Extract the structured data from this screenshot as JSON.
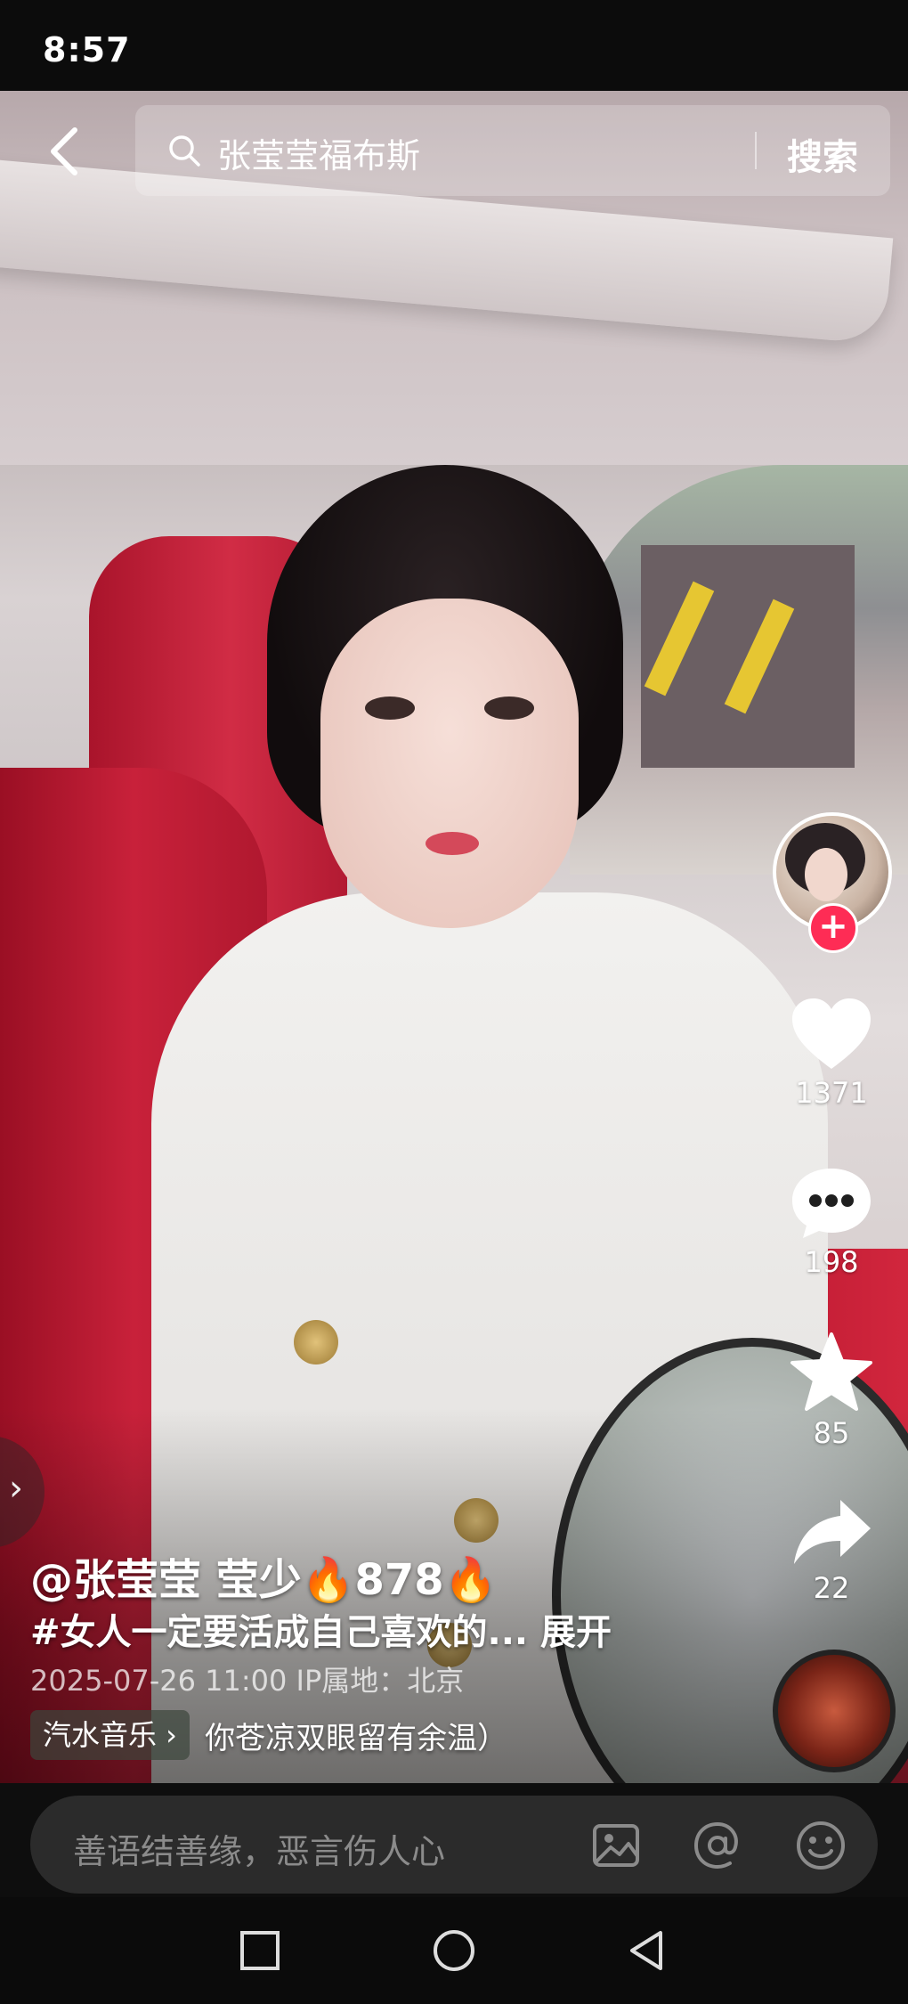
{
  "status_bar": {
    "time": "8:57"
  },
  "search": {
    "query": "张莹莹福布斯",
    "button_label": "搜索"
  },
  "sidebar_actions": {
    "likes": "1371",
    "comments": "198",
    "favorites": "85",
    "shares": "22"
  },
  "video_caption": {
    "author": "@张莹莹 莹少🔥878🔥",
    "description": "#女人一定要活成自己喜欢的... 展开",
    "meta": "2025-07-26 11:00  IP属地：北京",
    "music_tag": "汽水音乐 ›",
    "music_title": "你苍凉双眼留有余温）"
  },
  "comment_bar": {
    "placeholder": "善语结善缘，恶言伤人心"
  },
  "colors": {
    "accent": "#fe2c55",
    "background": "#0b0b0b"
  },
  "icons": [
    "back-icon",
    "search-icon",
    "heart-icon",
    "comment-icon",
    "star-icon",
    "share-icon",
    "image-icon",
    "at-icon",
    "emoji-icon",
    "square-nav-icon",
    "circle-nav-icon",
    "triangle-back-nav-icon"
  ]
}
